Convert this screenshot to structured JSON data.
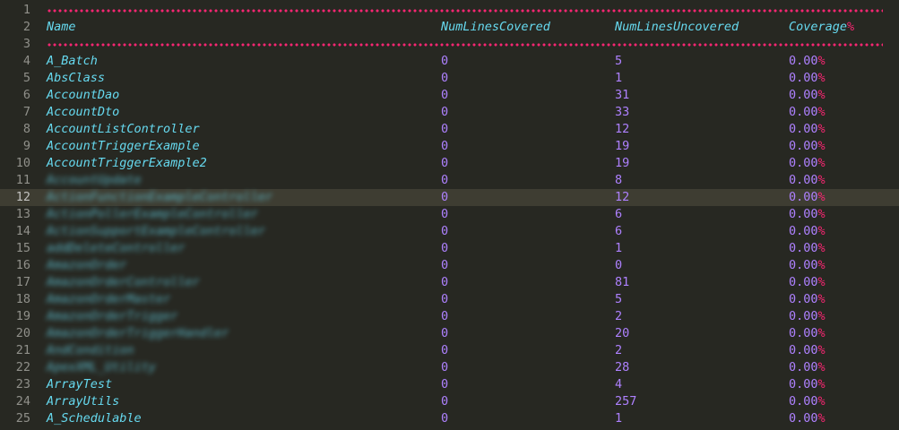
{
  "colors": {
    "background": "#272822",
    "name_text": "#66d9ef",
    "number_text": "#ae81ff",
    "percent_sign": "#f92672",
    "separator": "#f92672",
    "gutter_text": "#90908a"
  },
  "header": {
    "line_number": "2",
    "name": "Name",
    "covered": "NumLinesCovered",
    "uncovered": "NumLinesUncovered",
    "coverage": "Coverage",
    "coverage_suffix": "%"
  },
  "separators": [
    {
      "line_number": "1"
    },
    {
      "line_number": "3"
    }
  ],
  "current_line": "12",
  "rows": [
    {
      "line": "4",
      "name": "A_Batch",
      "covered": "0",
      "uncovered": "5",
      "coverage": "0.00",
      "pct": "%",
      "blurred": false
    },
    {
      "line": "5",
      "name": "AbsClass",
      "covered": "0",
      "uncovered": "1",
      "coverage": "0.00",
      "pct": "%",
      "blurred": false
    },
    {
      "line": "6",
      "name": "AccountDao",
      "covered": "0",
      "uncovered": "31",
      "coverage": "0.00",
      "pct": "%",
      "blurred": false
    },
    {
      "line": "7",
      "name": "AccountDto",
      "covered": "0",
      "uncovered": "33",
      "coverage": "0.00",
      "pct": "%",
      "blurred": false
    },
    {
      "line": "8",
      "name": "AccountListController",
      "covered": "0",
      "uncovered": "12",
      "coverage": "0.00",
      "pct": "%",
      "blurred": false
    },
    {
      "line": "9",
      "name": "AccountTriggerExample",
      "covered": "0",
      "uncovered": "19",
      "coverage": "0.00",
      "pct": "%",
      "blurred": false
    },
    {
      "line": "10",
      "name": "AccountTriggerExample2",
      "covered": "0",
      "uncovered": "19",
      "coverage": "0.00",
      "pct": "%",
      "blurred": false
    },
    {
      "line": "11",
      "name": "AccountUpdate",
      "covered": "0",
      "uncovered": "8",
      "coverage": "0.00",
      "pct": "%",
      "blurred": true
    },
    {
      "line": "12",
      "name": "ActionFunctionExampleController",
      "covered": "0",
      "uncovered": "12",
      "coverage": "0.00",
      "pct": "%",
      "blurred": true
    },
    {
      "line": "13",
      "name": "ActionPollerExampleController",
      "covered": "0",
      "uncovered": "6",
      "coverage": "0.00",
      "pct": "%",
      "blurred": true
    },
    {
      "line": "14",
      "name": "ActionSupportExampleController",
      "covered": "0",
      "uncovered": "6",
      "coverage": "0.00",
      "pct": "%",
      "blurred": true
    },
    {
      "line": "15",
      "name": "addDeleteController",
      "covered": "0",
      "uncovered": "1",
      "coverage": "0.00",
      "pct": "%",
      "blurred": true
    },
    {
      "line": "16",
      "name": "AmazonOrder",
      "covered": "0",
      "uncovered": "0",
      "coverage": "0.00",
      "pct": "%",
      "blurred": true
    },
    {
      "line": "17",
      "name": "AmazonOrderController",
      "covered": "0",
      "uncovered": "81",
      "coverage": "0.00",
      "pct": "%",
      "blurred": true
    },
    {
      "line": "18",
      "name": "AmazonOrderMaster",
      "covered": "0",
      "uncovered": "5",
      "coverage": "0.00",
      "pct": "%",
      "blurred": true
    },
    {
      "line": "19",
      "name": "AmazonOrderTrigger",
      "covered": "0",
      "uncovered": "2",
      "coverage": "0.00",
      "pct": "%",
      "blurred": true
    },
    {
      "line": "20",
      "name": "AmazonOrderTriggerHandler",
      "covered": "0",
      "uncovered": "20",
      "coverage": "0.00",
      "pct": "%",
      "blurred": true
    },
    {
      "line": "21",
      "name": "AndCondition",
      "covered": "0",
      "uncovered": "2",
      "coverage": "0.00",
      "pct": "%",
      "blurred": true
    },
    {
      "line": "22",
      "name": "ApexXML_Utility",
      "covered": "0",
      "uncovered": "28",
      "coverage": "0.00",
      "pct": "%",
      "blurred": true
    },
    {
      "line": "23",
      "name": "ArrayTest",
      "covered": "0",
      "uncovered": "4",
      "coverage": "0.00",
      "pct": "%",
      "blurred": false
    },
    {
      "line": "24",
      "name": "ArrayUtils",
      "covered": "0",
      "uncovered": "257",
      "coverage": "0.00",
      "pct": "%",
      "blurred": false
    },
    {
      "line": "25",
      "name": "A_Schedulable",
      "covered": "0",
      "uncovered": "1",
      "coverage": "0.00",
      "pct": "%",
      "blurred": false
    }
  ]
}
